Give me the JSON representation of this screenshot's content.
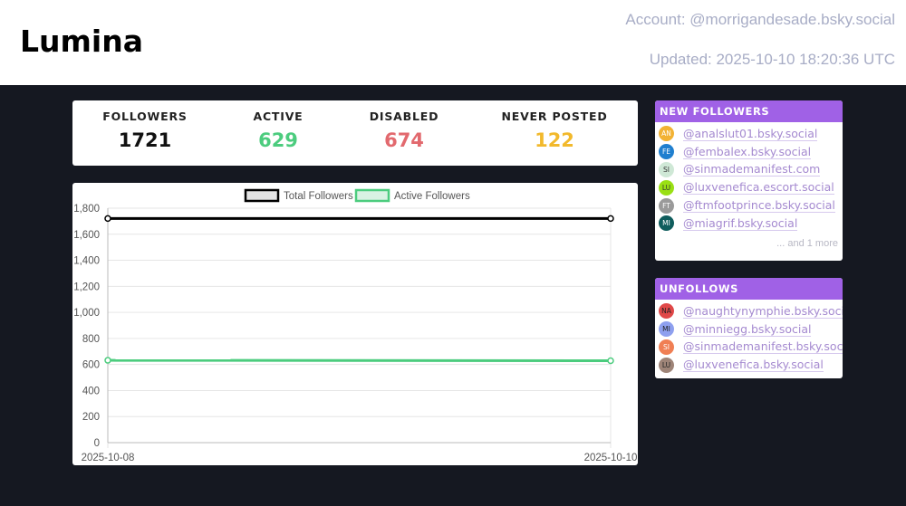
{
  "app": {
    "title": "Lumina"
  },
  "meta": {
    "account": "Account: @morrigandesade.bsky.social",
    "updated": "Updated: 2025-10-10 18:20:36 UTC"
  },
  "stats": [
    {
      "label": "FOLLOWERS",
      "value": "1721",
      "color": "#111111"
    },
    {
      "label": "ACTIVE",
      "value": "629",
      "color": "#4ccc7e"
    },
    {
      "label": "DISABLED",
      "value": "674",
      "color": "#e2696e"
    },
    {
      "label": "NEVER POSTED",
      "value": "122",
      "color": "#f2b92c"
    }
  ],
  "new_followers": {
    "title": "NEW FOLLOWERS",
    "items": [
      {
        "initials": "AN",
        "handle": "@analslut01.bsky.social",
        "color": "#f2b233",
        "text_color": "#ffffff"
      },
      {
        "initials": "FE",
        "handle": "@fembalex.bsky.social",
        "color": "#1f7fcf",
        "text_color": "#ffffff"
      },
      {
        "initials": "SI",
        "handle": "@sinmademanifest.com",
        "color": "#cfe8d6",
        "text_color": "#333333"
      },
      {
        "initials": "LU",
        "handle": "@luxvenefica.escort.social",
        "color": "#9ae014",
        "text_color": "#333333"
      },
      {
        "initials": "FT",
        "handle": "@ftmfootprince.bsky.social",
        "color": "#9a9a9a",
        "text_color": "#ffffff"
      },
      {
        "initials": "MI",
        "handle": "@miagrif.bsky.social",
        "color": "#0f5d5d",
        "text_color": "#ffffff"
      }
    ],
    "more": "... and 1 more"
  },
  "unfollows": {
    "title": "UNFOLLOWS",
    "items": [
      {
        "initials": "NA",
        "handle": "@naughtynymphie.bsky.social",
        "color": "#e04848",
        "text_color": "#222222"
      },
      {
        "initials": "MI",
        "handle": "@minniegg.bsky.social",
        "color": "#8ea0ef",
        "text_color": "#222222"
      },
      {
        "initials": "SI",
        "handle": "@sinmademanifest.bsky.social",
        "color": "#f07f54",
        "text_color": "#ffffff"
      },
      {
        "initials": "LU",
        "handle": "@luxvenefica.bsky.social",
        "color": "#9e8478",
        "text_color": "#222222"
      }
    ]
  },
  "chart_data": {
    "type": "line",
    "x": [
      "2025-10-08",
      "2025-10-10"
    ],
    "series": [
      {
        "name": "Total Followers",
        "values": [
          1721,
          1721
        ],
        "color": "#000000"
      },
      {
        "name": "Active Followers",
        "values": [
          632,
          629
        ],
        "color": "#4ccc7e"
      }
    ],
    "ylim": [
      0,
      1800
    ],
    "yticks": [
      "0",
      "200",
      "400",
      "600",
      "800",
      "1,000",
      "1,200",
      "1,400",
      "1,600",
      "1,800"
    ],
    "legend": "top",
    "grid": true
  }
}
